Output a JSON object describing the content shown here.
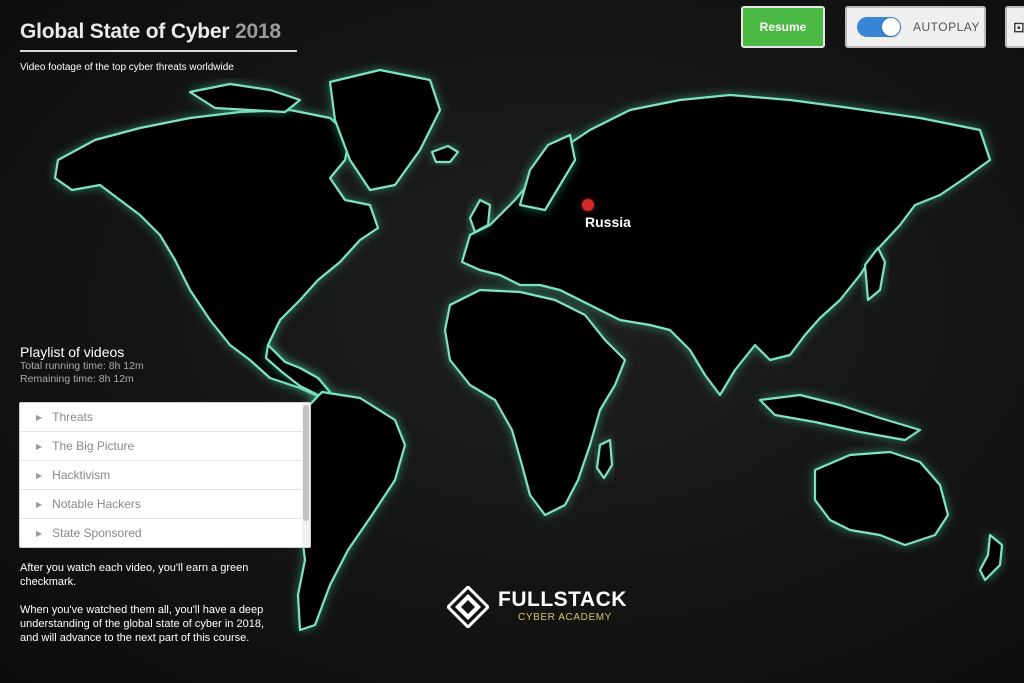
{
  "header": {
    "title": "Global State of Cyber",
    "title_year": "2018",
    "subtitle": "Video footage of the top cyber threats worldwide"
  },
  "toolbar": {
    "resume_label": "Resume",
    "autoplay_label": "AUTOPLAY",
    "autoplay_on": true
  },
  "map": {
    "marker_label": "Russia",
    "marker_color": "#d32a26",
    "outline_color": "#7fe3c2"
  },
  "playlist": {
    "heading": "Playlist of videos",
    "total_running": "Total running time: 8h 12m",
    "remaining": "Remaining time: 8h 12m",
    "items": [
      {
        "label": "Threats"
      },
      {
        "label": "The Big Picture"
      },
      {
        "label": "Hacktivism"
      },
      {
        "label": "Notable Hackers"
      },
      {
        "label": "State Sponsored"
      }
    ]
  },
  "info": {
    "line1": "After you watch each video, you'll earn a green checkmark.",
    "line2": "When you've watched them all, you'll have a deep understanding of the global state of cyber in 2018, and will advance to the next part of this course."
  },
  "brand": {
    "name": "FULLSTACK",
    "tagline": "CYBER ACADEMY",
    "accent": "#d9c070"
  },
  "icons": {
    "toggle": "toggle-switch-icon",
    "caret": "caret-right-icon",
    "logo": "fullstack-diamond-logo"
  }
}
